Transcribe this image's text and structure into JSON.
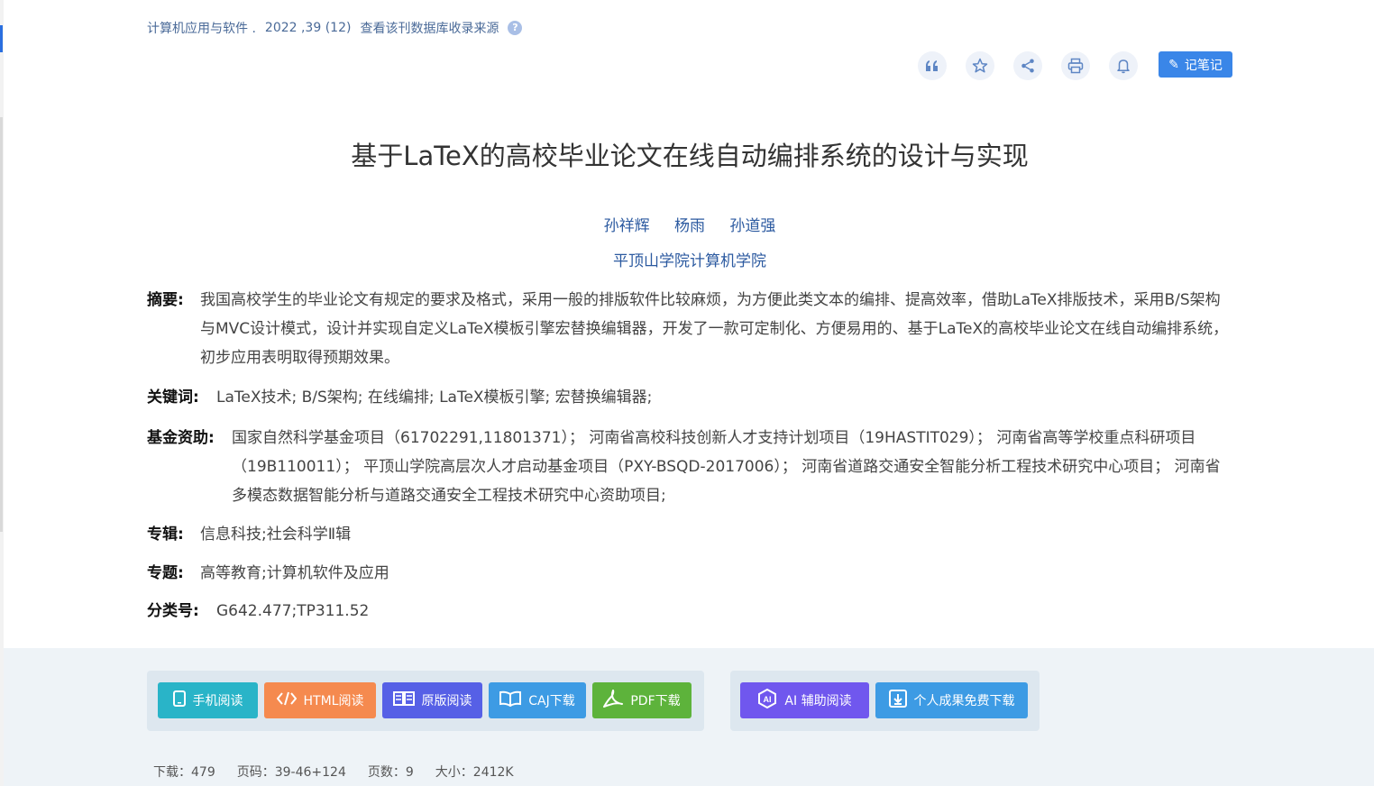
{
  "source": {
    "journal": "计算机应用与软件 .",
    "issue": "2022 ,39 (12)",
    "db_link": "查看该刊数据库收录来源",
    "help_icon": "?"
  },
  "toolbar": {
    "cite_icon": "quote-icon",
    "favorite_icon": "star-icon",
    "share_icon": "share-icon",
    "print_icon": "print-icon",
    "alert_icon": "bell-icon",
    "note_label": "记笔记"
  },
  "paper": {
    "title": "基于LaTeX的高校毕业论文在线自动编排系统的设计与实现",
    "authors": [
      "孙祥辉",
      "杨雨",
      "孙道强"
    ],
    "affiliation": "平顶山学院计算机学院",
    "abstract_label": "摘要:",
    "abstract": "我国高校学生的毕业论文有规定的要求及格式，采用一般的排版软件比较麻烦，为方便此类文本的编排、提高效率，借助LaTeX排版技术，采用B/S架构与MVC设计模式，设计并实现自定义LaTeX模板引擎宏替换编辑器，开发了一款可定制化、方便易用的、基于LaTeX的高校毕业论文在线自动编排系统，初步应用表明取得预期效果。",
    "keywords_label": "关键词:",
    "keywords": "LaTeX技术;  B/S架构;  在线编排;  LaTeX模板引擎;  宏替换编辑器;",
    "funding_label": "基金资助:",
    "funding": "国家自然科学基金项目（61702291,11801371）；  河南省高校科技创新人才支持计划项目（19HASTIT029）；  河南省高等学校重点科研项目（19B110011）；  平顶山学院高层次人才启动基金项目（PXY-BSQD-2017006）；  河南省道路交通安全智能分析工程技术研究中心项目；  河南省多模态数据智能分析与道路交通安全工程技术研究中心资助项目;",
    "album_label": "专辑:",
    "album": "信息科技;社会科学Ⅱ辑",
    "topic_label": "专题:",
    "topic": "高等教育;计算机软件及应用",
    "clc_label": "分类号:",
    "clc": "G642.477;TP311.52"
  },
  "actions": {
    "phone_read": "手机阅读",
    "html_read": "HTML阅读",
    "original_read": "原版阅读",
    "caj_download": "CAJ下载",
    "pdf_download": "PDF下载",
    "ai_read": "AI 辅助阅读",
    "free_download": "个人成果免费下载"
  },
  "stats": {
    "downloads": "下载：479",
    "pages_range": "页码：39-46+124",
    "page_count": "页数：9",
    "size": "大小：2412K"
  },
  "colors": {
    "link_blue": "#2c5aa0",
    "note_button": "#3a86e8",
    "phone": "#29b4c8",
    "html": "#f58a4f",
    "original": "#5660e6",
    "caj": "#3d9be4",
    "pdf": "#5db33b",
    "ai": "#7057ee",
    "free": "#3d9be4"
  }
}
